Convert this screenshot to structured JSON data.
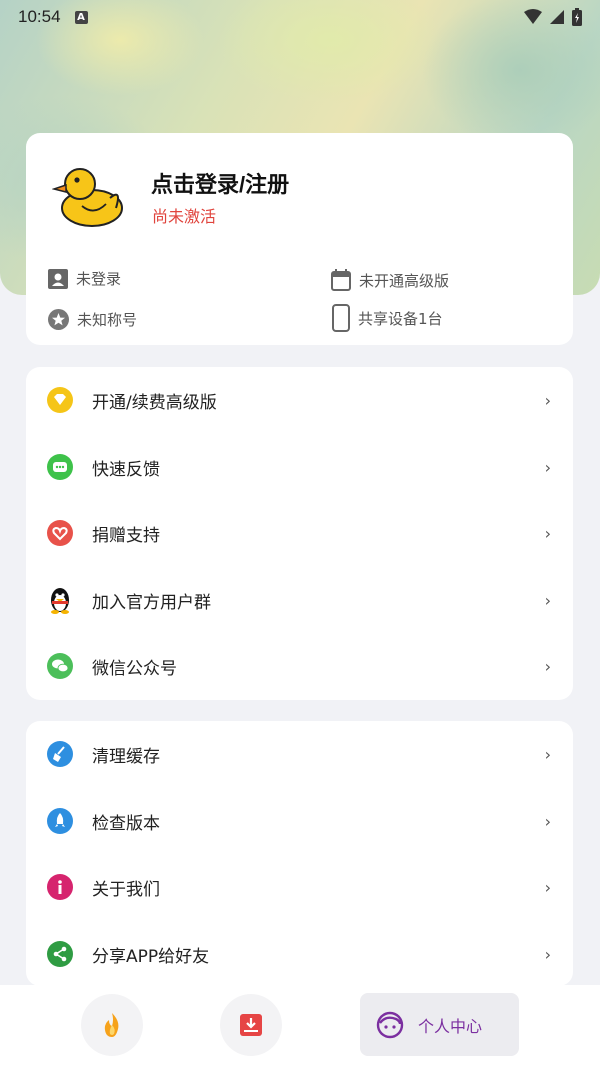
{
  "status_bar": {
    "time": "10:54",
    "notif": "A"
  },
  "profile": {
    "title": "点击登录/注册",
    "status": "尚未激活",
    "info": {
      "login": "未登录",
      "plan": "未开通高级版",
      "nickname": "未知称号",
      "devices": "共享设备1台"
    }
  },
  "menu_group_1": [
    {
      "label": "开通/续费高级版",
      "icon": "diamond-icon"
    },
    {
      "label": "快速反馈",
      "icon": "chat-icon"
    },
    {
      "label": "捐赠支持",
      "icon": "heart-icon"
    },
    {
      "label": "加入官方用户群",
      "icon": "qq-penguin-icon"
    },
    {
      "label": "微信公众号",
      "icon": "wechat-icon"
    }
  ],
  "menu_group_2": [
    {
      "label": "清理缓存",
      "icon": "broom-icon"
    },
    {
      "label": "检查版本",
      "icon": "rocket-icon"
    },
    {
      "label": "关于我们",
      "icon": "info-icon"
    },
    {
      "label": "分享APP给好友",
      "icon": "share-icon"
    }
  ],
  "bottom_nav": {
    "active_label": "个人中心"
  },
  "colors": {
    "accent_purple": "#7b2fa0",
    "inactive_red": "#e0443d"
  }
}
